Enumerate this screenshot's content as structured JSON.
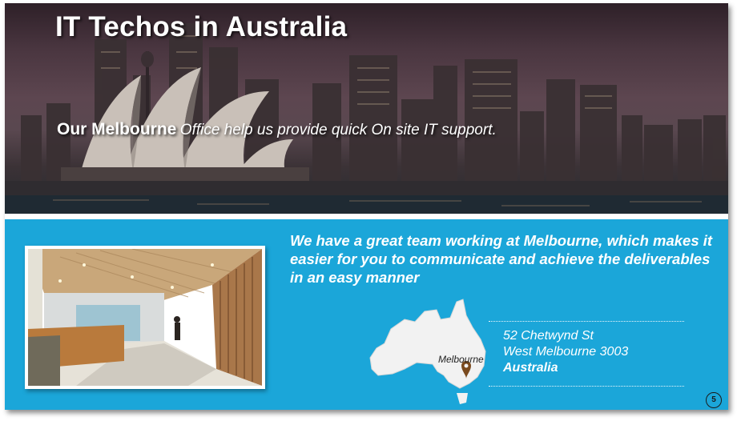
{
  "slide": {
    "title": "IT Techos in Australia",
    "tagline_bold": "Our Melbourne",
    "tagline_italic": "Office help us provide quick On site IT support.",
    "blurb": "We have a great team working at Melbourne, which makes it easier for you to communicate and achieve the deliverables in an easy manner",
    "map_label": "Melbourne",
    "address": {
      "line1": "52 Chetwynd St",
      "line2": "West Melbourne 3003",
      "country": "Australia"
    },
    "page_number": "5"
  },
  "colors": {
    "band_blue": "#1ba6d9",
    "title_white": "#ffffff",
    "map_fill": "#f2f2f2",
    "pin_brown": "#7a4a1e"
  },
  "images": {
    "background": "sydney-skyline-opera-house-at-dusk",
    "photo": "office-reception-lobby-wood-paneling"
  },
  "icons": {
    "pin": "map-pin-icon"
  }
}
